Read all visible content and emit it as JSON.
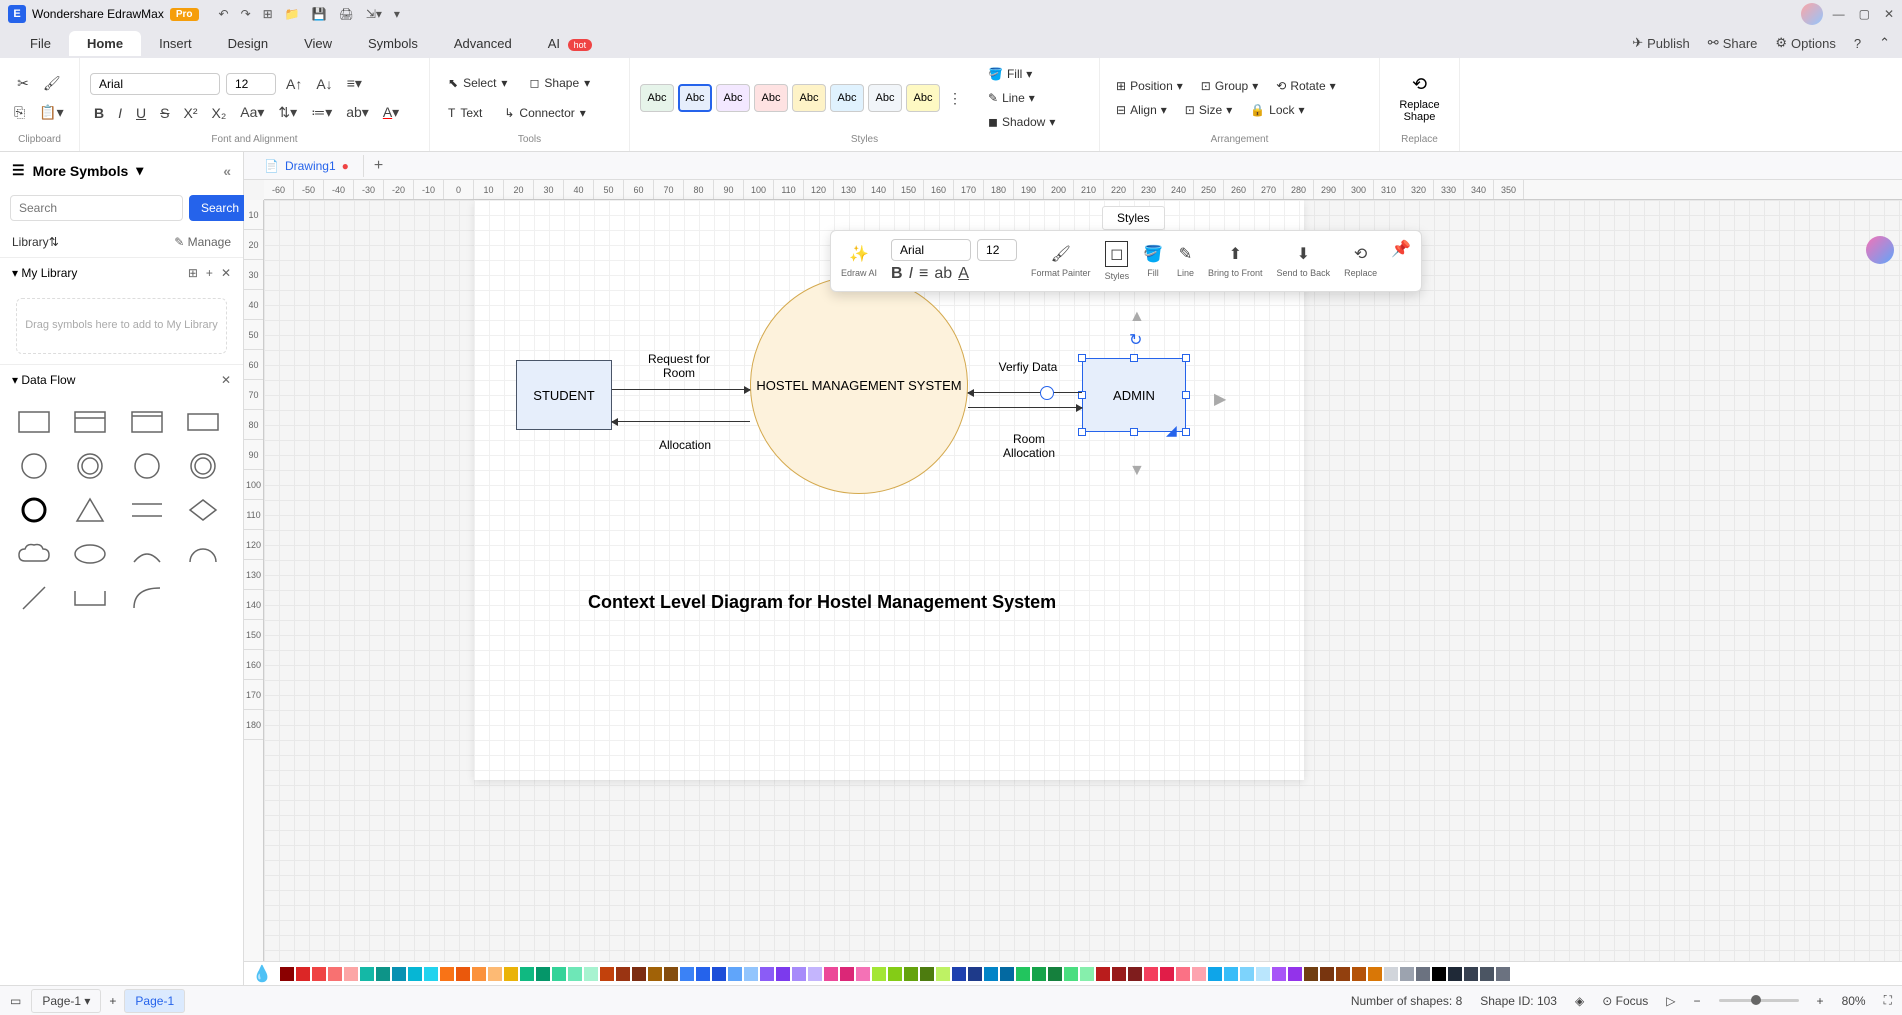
{
  "app": {
    "name": "Wondershare EdrawMax",
    "badge": "Pro"
  },
  "menus": {
    "file": "File",
    "home": "Home",
    "insert": "Insert",
    "design": "Design",
    "view": "View",
    "symbols": "Symbols",
    "advanced": "Advanced",
    "ai": "AI",
    "ai_badge": "hot"
  },
  "top_actions": {
    "publish": "Publish",
    "share": "Share",
    "options": "Options"
  },
  "ribbon": {
    "font_name": "Arial",
    "font_size": "12",
    "select": "Select",
    "shape": "Shape",
    "text": "Text",
    "connector": "Connector",
    "fill": "Fill",
    "line": "Line",
    "shadow": "Shadow",
    "position": "Position",
    "group": "Group",
    "rotate": "Rotate",
    "align": "Align",
    "size": "Size",
    "lock": "Lock",
    "replace_shape": "Replace Shape",
    "groups": {
      "clipboard": "Clipboard",
      "font": "Font and Alignment",
      "tools": "Tools",
      "styles": "Styles",
      "arrangement": "Arrangement",
      "replace": "Replace"
    },
    "swatch": "Abc"
  },
  "tabs": {
    "drawing": "Drawing1"
  },
  "left": {
    "more_symbols": "More Symbols",
    "search_placeholder": "Search",
    "search_btn": "Search",
    "library": "Library",
    "manage": "Manage",
    "my_library": "My Library",
    "dropzone": "Drag symbols here to add to My Library",
    "data_flow": "Data Flow"
  },
  "diagram": {
    "student": "STUDENT",
    "system": "HOSTEL MANAGEMENT SYSTEM",
    "admin": "ADMIN",
    "req_room": "Request for Room",
    "allocation": "Allocation",
    "verify": "Verfiy Data",
    "room_alloc": "Room Allocation",
    "title": "Context Level Diagram for Hostel Management System"
  },
  "float": {
    "styles_tab": "Styles",
    "font": "Arial",
    "size": "12",
    "edraw_ai": "Edraw AI",
    "format_painter": "Format Painter",
    "styles": "Styles",
    "fill": "Fill",
    "line": "Line",
    "btf": "Bring to Front",
    "stb": "Send to Back",
    "replace": "Replace"
  },
  "status": {
    "page": "Page-1",
    "shapes": "Number of shapes: 8",
    "shape_id": "Shape ID: 103",
    "focus": "Focus",
    "zoom": "80%"
  },
  "ruler_h": [
    "-60",
    "-50",
    "-40",
    "-30",
    "-20",
    "-10",
    "0",
    "10",
    "20",
    "30",
    "40",
    "50",
    "60",
    "70",
    "80",
    "90",
    "100",
    "110",
    "120",
    "130",
    "140",
    "150",
    "160",
    "170",
    "180",
    "190",
    "200",
    "210",
    "220",
    "230",
    "240",
    "250",
    "260",
    "270",
    "280",
    "290",
    "300",
    "310",
    "320",
    "330",
    "340",
    "350"
  ],
  "ruler_v": [
    "10",
    "20",
    "30",
    "40",
    "50",
    "60",
    "70",
    "80",
    "90",
    "100",
    "110",
    "120",
    "130",
    "140",
    "150",
    "160",
    "170",
    "180"
  ],
  "colors": [
    "#8b0000",
    "#dc2626",
    "#ef4444",
    "#f87171",
    "#fca5a5",
    "#14b8a6",
    "#0d9488",
    "#0891b2",
    "#06b6d4",
    "#22d3ee",
    "#f97316",
    "#ea580c",
    "#fb923c",
    "#fdba74",
    "#eab308",
    "#10b981",
    "#059669",
    "#34d399",
    "#6ee7b7",
    "#a7f3d0",
    "#c2410c",
    "#9a3412",
    "#7c2d12",
    "#a16207",
    "#854d0e",
    "#3b82f6",
    "#2563eb",
    "#1d4ed8",
    "#60a5fa",
    "#93c5fd",
    "#8b5cf6",
    "#7c3aed",
    "#a78bfa",
    "#c4b5fd",
    "#ec4899",
    "#db2777",
    "#f472b6",
    "#a3e635",
    "#84cc16",
    "#65a30d",
    "#4d7c0f",
    "#bef264",
    "#1e40af",
    "#1e3a8a",
    "#0284c7",
    "#0369a1",
    "#22c55e",
    "#16a34a",
    "#15803d",
    "#4ade80",
    "#86efac",
    "#b91c1c",
    "#991b1b",
    "#7f1d1d",
    "#f43f5e",
    "#e11d48",
    "#fb7185",
    "#fda4af",
    "#0ea5e9",
    "#38bdf8",
    "#7dd3fc",
    "#bae6fd",
    "#a855f7",
    "#9333ea",
    "#713f12",
    "#78350f",
    "#92400e",
    "#b45309",
    "#d97706",
    "#d1d5db",
    "#9ca3af",
    "#6b7280",
    "#000000",
    "#1f2937",
    "#374151",
    "#4b5563",
    "#6b7280",
    "#ffffff"
  ]
}
